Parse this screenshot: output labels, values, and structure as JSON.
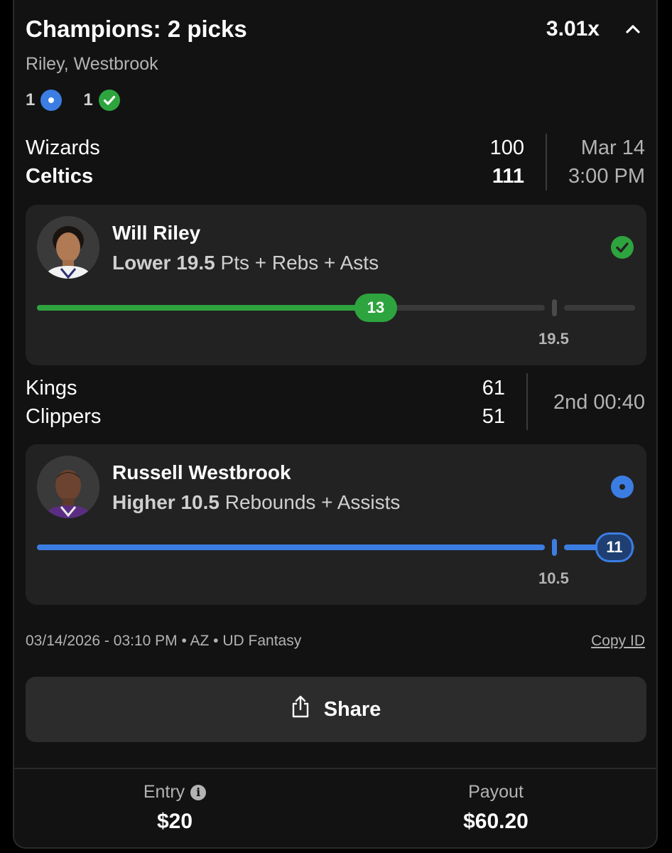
{
  "header": {
    "title": "Champions: 2 picks",
    "multiplier": "3.01x",
    "players": "Riley, Westbrook",
    "pending_count": "1",
    "won_count": "1"
  },
  "games": [
    {
      "team1": "Wizards",
      "score1": "100",
      "team2": "Celtics",
      "score2": "111",
      "time_line1": "Mar 14",
      "time_line2": "3:00 PM"
    },
    {
      "team1": "Kings",
      "score1": "61",
      "team2": "Clippers",
      "score2": "51",
      "time_line1": "2nd 00:40"
    }
  ],
  "picks": [
    {
      "player": "Will Riley",
      "direction_line": "Lower 19.5",
      "stat": "Pts + Rebs + Asts",
      "current": "13",
      "line": "19.5",
      "progress_fraction": 0.667,
      "status": "won",
      "color": "#2ea43f"
    },
    {
      "player": "Russell Westbrook",
      "direction_line": "Higher 10.5",
      "stat": "Rebounds + Assists",
      "current": "11",
      "line": "10.5",
      "progress_fraction": 1.0,
      "status": "live",
      "color": "#3b7de3"
    }
  ],
  "footer": {
    "meta": "03/14/2026 - 03:10 PM • AZ • UD Fantasy",
    "copy_id": "Copy ID",
    "share": "Share",
    "entry_label": "Entry",
    "entry_value": "$20",
    "payout_label": "Payout",
    "payout_value": "$60.20"
  },
  "icons": [
    "chevron-up-icon",
    "pending-dot-icon",
    "check-circle-icon",
    "share-icon",
    "info-icon"
  ]
}
